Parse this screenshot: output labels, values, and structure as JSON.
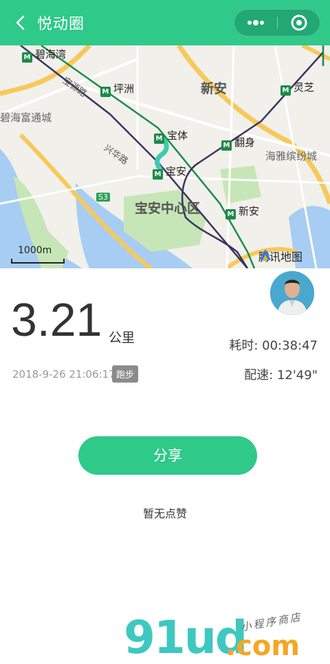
{
  "header": {
    "title": "悦动圈",
    "back_icon": "chevron-left-icon",
    "more_icon": "more-dots-icon",
    "close_icon": "target-close-icon"
  },
  "map": {
    "places": {
      "bihaiwan": "碧海湾",
      "pingzhou": "坪洲",
      "xinan_area": "新安",
      "lingzhi": "灵芝",
      "bihai_fu": "碧海富通城",
      "baoti": "宝体",
      "fanshen": "翻身",
      "haiya": "海雅缤纷城",
      "baoan": "宝安",
      "road_a": "宝源路",
      "road_b": "兴华路",
      "s3": "S3",
      "baoan_center": "宝安中心区",
      "xinan_station": "新安"
    },
    "scale": "1000m",
    "provider": "腾讯地图"
  },
  "stats": {
    "distance": "3.21",
    "unit": "公里",
    "duration": "耗时: 00:38:47",
    "pace": "配速: 12'49\"",
    "datetime": "2018-9-26 21:06:17",
    "activity": "跑步"
  },
  "actions": {
    "share": "分享",
    "likes": "暂无点赞"
  },
  "watermark": {
    "brand": "91ud",
    "tld": ".com",
    "slogan": "小程序商店"
  },
  "colors": {
    "accent": "#2fc98a",
    "metro": "#1d8a4a",
    "route": "#3fc9b0"
  }
}
